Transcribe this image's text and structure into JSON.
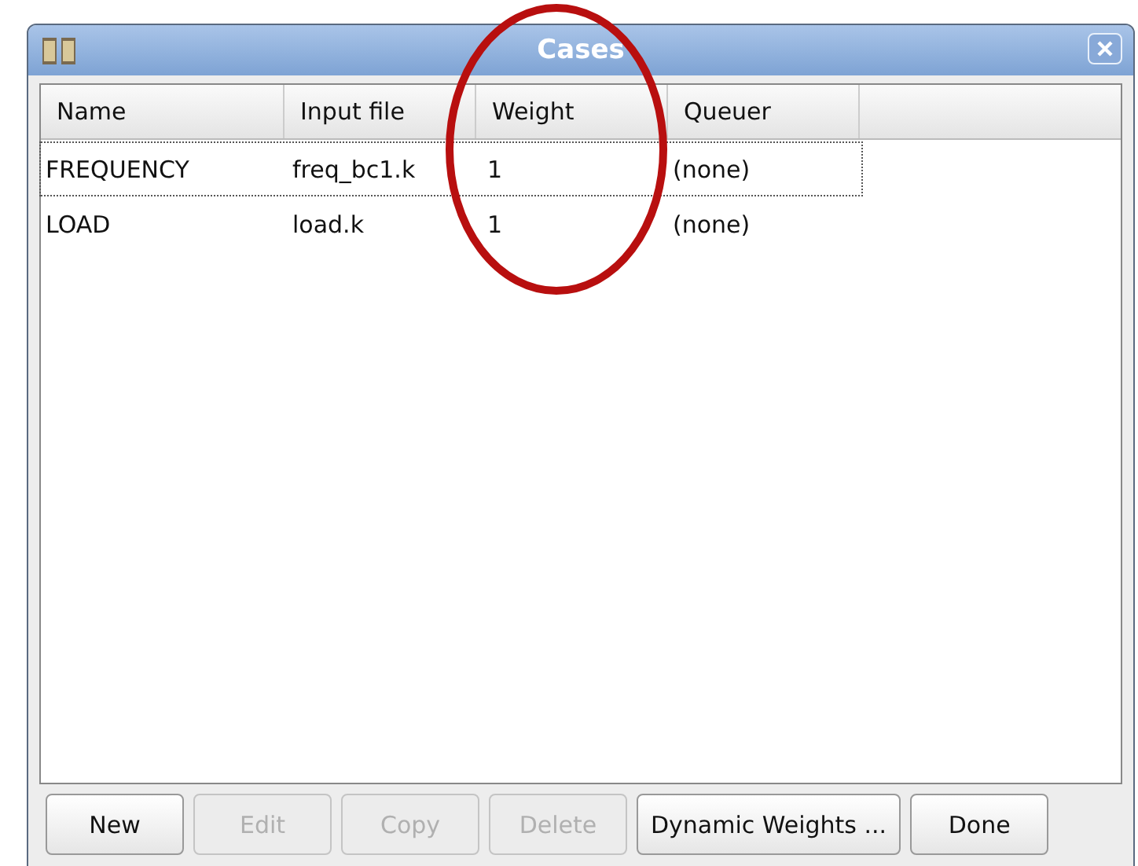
{
  "window": {
    "title": "Cases"
  },
  "table": {
    "columns": [
      "Name",
      "Input file",
      "Weight",
      "Queuer"
    ],
    "rows": [
      {
        "cells": [
          "FREQUENCY",
          "freq_bc1.k",
          "1",
          "(none)"
        ],
        "selected": true
      },
      {
        "cells": [
          "LOAD",
          "load.k",
          "1",
          "(none)"
        ],
        "selected": false
      }
    ]
  },
  "buttons": [
    {
      "label": "New",
      "disabled": false
    },
    {
      "label": "Edit",
      "disabled": true
    },
    {
      "label": "Copy",
      "disabled": true
    },
    {
      "label": "Delete",
      "disabled": true
    },
    {
      "label": "Dynamic Weights ...",
      "disabled": false
    },
    {
      "label": "Done",
      "disabled": false
    }
  ]
}
